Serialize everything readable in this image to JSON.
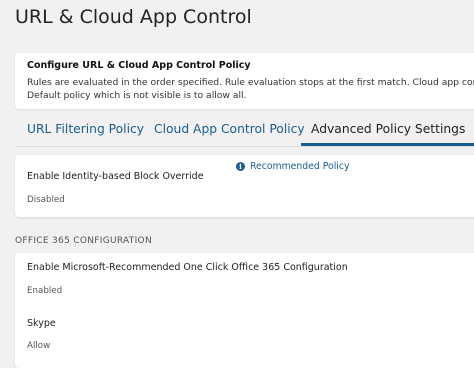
{
  "page": {
    "title": "URL & Cloud App Control"
  },
  "info": {
    "heading": "Configure URL & Cloud App Control Policy",
    "line1": "Rules are evaluated in the order specified. Rule evaluation stops at the first match. Cloud app control po",
    "line2": "Default policy which is not visible is to allow all."
  },
  "tabs": [
    {
      "label": "URL Filtering Policy",
      "active": false
    },
    {
      "label": "Cloud App Control Policy",
      "active": false
    },
    {
      "label": "Advanced Policy Settings",
      "active": true
    }
  ],
  "advanced": {
    "recommended_link": "Recommended Policy",
    "recommended_icon": "info-icon",
    "block_override": {
      "label": "Enable Identity-based Block Override",
      "value": "Disabled"
    }
  },
  "office365": {
    "section_title": "OFFICE 365 CONFIGURATION",
    "one_click": {
      "label": "Enable Microsoft-Recommended One Click Office 365 Configuration",
      "value": "Enabled"
    },
    "skype": {
      "label": "Skype",
      "value": "Allow"
    }
  },
  "colors": {
    "accent": "#1a5d8f",
    "background": "#f1f1f1",
    "card": "#ffffff"
  }
}
